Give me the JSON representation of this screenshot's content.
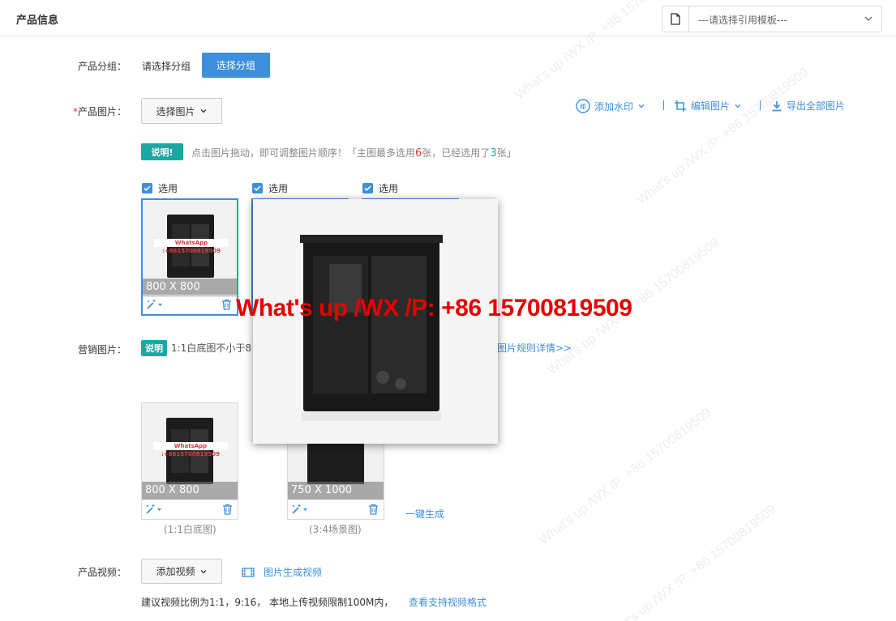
{
  "header": {
    "title": "产品信息",
    "template_placeholder": "---请选择引用模板---"
  },
  "group": {
    "label": "产品分组：",
    "placeholder": "请选择分组",
    "button": "选择分组"
  },
  "images": {
    "required_mark": "*",
    "label": "产品图片：",
    "select_button": "选择图片",
    "tag": "说明!",
    "hint_part1": "点击图片拖动，即可调整图片顺序！「主图最多选用",
    "max_count": "6",
    "hint_part2": "张，已经选用了",
    "used_count": "3",
    "hint_part3": "张」",
    "check_label": "选用",
    "thumb1_size": "800 X 800",
    "watermark_badge": "WhatsApp :+8615700819509"
  },
  "toolbar": {
    "watermark": "添加水印",
    "edit": "编辑图片",
    "export": "导出全部图片"
  },
  "marketing": {
    "label": "营销图片：",
    "tag": "说明",
    "hint": "1:1白底图不小于8",
    "rules_link": "图片规则详情>>",
    "thumb1_size": "800 X 800",
    "thumb2_size": "750 X 1000",
    "caption1": "(1:1白底图)",
    "caption2": "(3:4场景图)",
    "generate": "一键生成"
  },
  "video": {
    "label": "产品视频：",
    "add_button": "添加视频",
    "generate_link": "图片生成视频",
    "hint": "建议视频比例为1:1，9:16， 本地上传视频限制100M内，",
    "formats_link": "查看支持视频格式"
  },
  "preview": {
    "overlay": "What's up /WX /P: +86 15700819509"
  },
  "colors": {
    "accent": "#3e8fdc",
    "tag_green": "#1aa9a2",
    "overlay_red": "#e60000"
  }
}
